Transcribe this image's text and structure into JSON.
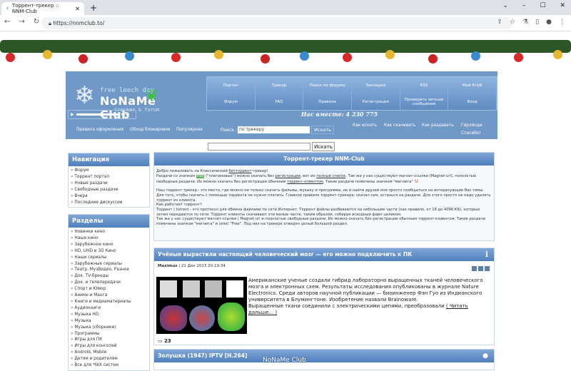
{
  "browser": {
    "tab_title": "Торрент-трекер :: NNM-Club",
    "url": "https://nnmclub.to/"
  },
  "header": {
    "logo_line1": "free leech day",
    "logo_line2": "NoNaMe Club",
    "logo_line3": "tracker & forum",
    "menu": [
      "Портал",
      "Трекер",
      "Поиск по форуму",
      "Закладки",
      "RSS",
      "Мой Клуб",
      "Форум",
      "FAQ",
      "Правила",
      "Регистрация",
      "Проверить личные сообщения",
      "Вход"
    ],
    "together": "Нас вместе: 4 230 775",
    "links": [
      "Правила оформления",
      "Обход блокировок",
      "Популярное"
    ],
    "search_label": "Поиск :",
    "search_value": "по трекеру",
    "search_button": "Искать",
    "help_links": [
      "Как искать",
      "Как скачивать",
      "Как раздавать",
      "Гирлянда",
      "Спасибо!"
    ]
  },
  "global_search": {
    "button": "Искать"
  },
  "navigation": {
    "title": "Навигация",
    "items": [
      "Форум",
      "Торрент портал",
      "Новые раздачи",
      "Свободные раздачи",
      "Вчера",
      "Последние дискуссии"
    ]
  },
  "sections": {
    "title": "Разделы",
    "items": [
      "Новинки кино",
      "Наше кино",
      "Зарубежное кино",
      "HD, UHD и 3D Кино",
      "Наши сериалы",
      "Зарубежные сериалы",
      "Театр, МузВидео, Разное",
      "Док. TV-бренды",
      "Док. и телепередачи",
      "Спорт и Юмор",
      "Аниме и Манга",
      "Книги и медиаматериалы",
      "Аудиокниги",
      "Музыка HD",
      "Музыка",
      "Музыка (сборники)",
      "Программы",
      "Игры для ПК",
      "Игры для консолей",
      "Android, Mobile",
      "Детям и родителям",
      "Все для *NIX систем"
    ]
  },
  "welcome": {
    "title": "Торрент-трекер NNM-Club",
    "p1": "Добро пожаловать на Классический",
    "p1_link": "битторрент",
    "p1_end": "-трекер!",
    "p2a": "Раздачи со значком",
    "free": "Free",
    "p2b": "(\"платиновые\") можно скачать без",
    "p2_link1": "регистрации",
    "p2c": ", вот их",
    "p2_link2": "полный список",
    "p2d": ". Так же у нас существуют магнет-ссылки (Magnet-url), полностью свободные раздачи. Их можно скачать без регистрации обычным",
    "p2_link3": "торрент-клиентом",
    "p2e": ". Такие раздачи помечены значком \"магнита\"",
    "p3": "Наш торрент-трекер - это место, где можно не только скачать фильмы, музыку и программы, но и найти друзей или просто пообщаться на интересующие Вас темы. Для того, чтобы скачать с помощью торрента не нужно платить. Главное правило торрент-трекера: скачал сам, останься на раздаче. Для этого просто не надо удалять торрент из клиента.",
    "p4": "Как работает торрент?",
    "p5": "Торрент | torrent - это протокол для обмена файлами по сети Интернет. Торрент файлы разбиваются на небольшие части (как правило, от 16 до 4096 КБ), которые затем передаются по сети. Торрент клиенты скачивают эти малые части, таким образом, собирая исходный файл целиком.",
    "p6": "Так же у нас существуют магнет-ссылки | Magnet-url и полностью свободные раздачи. Их можно скачать без регистрации обычным торрент-клиентом. Такие раздачи помечены значком \"магнита\" и (или) \"Free\". Под них на трекере отведен целый большой раздел."
  },
  "news": {
    "title": "Учёные вырастили настоящий человеческий мозг — его можно подключить к ПК",
    "author": "Maximus",
    "date": "| 21 Дек 2023 20:19:34",
    "text": "Американские ученые создали гибрид лабораторно выращенных тканей человеческого мозга и электронных схем. Результаты исследования опубликованы в журнале Nature Electronics. Среди авторов научной публикации — биоинженер Фэн Гуо из Индианского университета в Блумингтоне. Изобретение назвали Brainoware.",
    "text2": "Выращенные ткани соединили с электрическими цепями, преобразовали",
    "read_more": "( Читать дальше... )",
    "comments": "23"
  },
  "next_post": {
    "title": "Золушка (1947) IPTV [H.264]"
  },
  "watermark": "NoNaMe Club"
}
